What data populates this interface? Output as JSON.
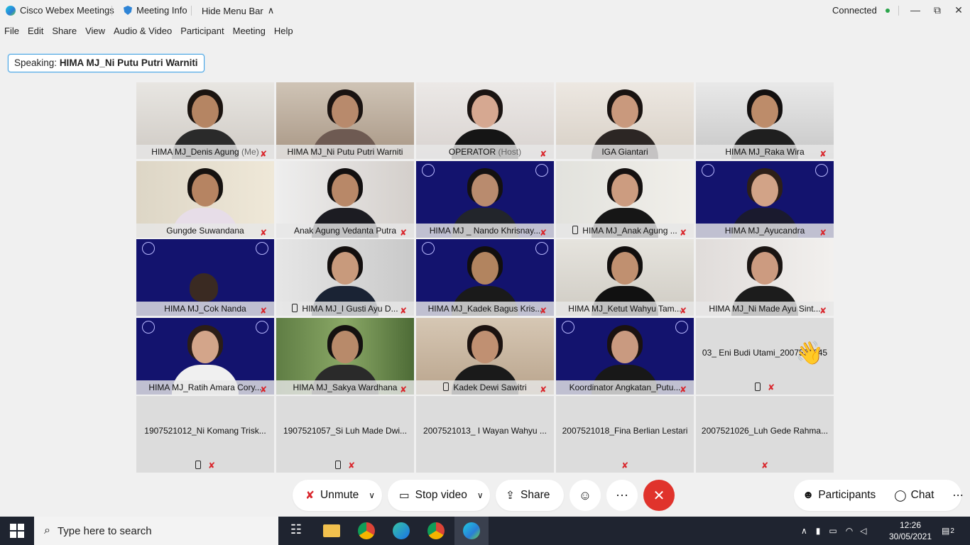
{
  "titlebar": {
    "app": "Cisco Webex Meetings",
    "meeting_info": "Meeting Info",
    "hide_menu": "Hide Menu Bar",
    "status": "Connected"
  },
  "menu": [
    "File",
    "Edit",
    "Share",
    "View",
    "Audio & Video",
    "Participant",
    "Meeting",
    "Help"
  ],
  "speaking": {
    "prefix": "Speaking:",
    "name": "HIMA MJ_Ni Putu Putri Warniti"
  },
  "tiles": [
    {
      "name": "HIMA MJ_Denis Agung",
      "suffix": "(Me)"
    },
    {
      "name": "HIMA MJ_Ni Putu Putri Warniti"
    },
    {
      "name": "OPERATOR",
      "suffix": "(Host)"
    },
    {
      "name": "IGA Giantari"
    },
    {
      "name": "HIMA MJ_Raka Wira"
    },
    {
      "name": "Gungde Suwandana"
    },
    {
      "name": "Anak Agung Vedanta Putra"
    },
    {
      "name": "HIMA MJ _ Nando Khrisnay..."
    },
    {
      "name": "HIMA MJ_Anak Agung ..."
    },
    {
      "name": "HIMA MJ_Ayucandra"
    },
    {
      "name": "HIMA MJ_Cok Nanda"
    },
    {
      "name": "HIMA MJ_I Gusti Ayu D..."
    },
    {
      "name": "HIMA MJ_Kadek Bagus Kris..."
    },
    {
      "name": "HIMA MJ_Ketut Wahyu Tam..."
    },
    {
      "name": "HIMA MJ_Ni Made Ayu Sint..."
    },
    {
      "name": "HIMA MJ_Ratih Amara Cory..."
    },
    {
      "name": "HIMA MJ_Sakya Wardhana"
    },
    {
      "name": "Kadek Dewi Sawitri"
    },
    {
      "name": "Koordinator Angkatan_Putu..."
    },
    {
      "name": "03_ Eni Budi Utami_2007521045"
    },
    {
      "name": "1907521012_Ni Komang Trisk..."
    },
    {
      "name": "1907521057_Si Luh Made Dwi..."
    },
    {
      "name": "2007521013_ I Wayan Wahyu ..."
    },
    {
      "name": "2007521018_Fina Berlian Lestari"
    },
    {
      "name": "2007521026_Luh Gede Rahma..."
    }
  ],
  "controls": {
    "unmute": "Unmute",
    "stop_video": "Stop video",
    "share": "Share",
    "participants": "Participants",
    "chat": "Chat"
  },
  "taskbar": {
    "search_placeholder": "Type here to search",
    "time": "12:26",
    "date": "30/05/2021",
    "notifications": "2"
  }
}
